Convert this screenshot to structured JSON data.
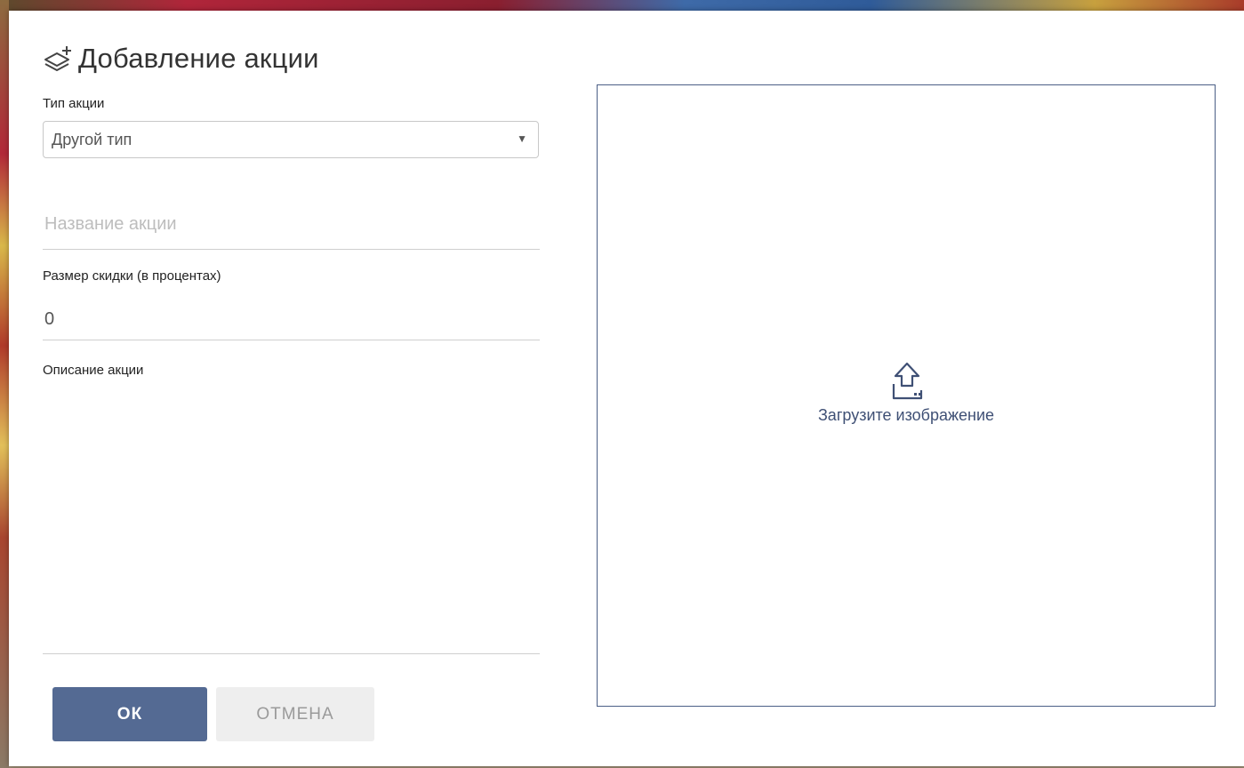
{
  "dialog": {
    "title": "Добавление акции",
    "title_icon": "add-layers-icon"
  },
  "form": {
    "type_label": "Тип акции",
    "type_value": "Другой тип",
    "type_caret_icon": "caret-down-icon",
    "name_placeholder": "Название акции",
    "name_value": "",
    "discount_label": "Размер скидки (в процентах)",
    "discount_value": "0",
    "description_label": "Описание акции",
    "description_value": ""
  },
  "image_upload": {
    "icon": "upload-icon",
    "label": "Загрузите изображение"
  },
  "buttons": {
    "ok_label": "ОК",
    "cancel_label": "ОТМЕНА"
  },
  "colors": {
    "primary": "#546a93",
    "dropzone_border": "#4b5f86",
    "upload_text": "#3f5075",
    "cancel_bg": "#eeeeee"
  }
}
